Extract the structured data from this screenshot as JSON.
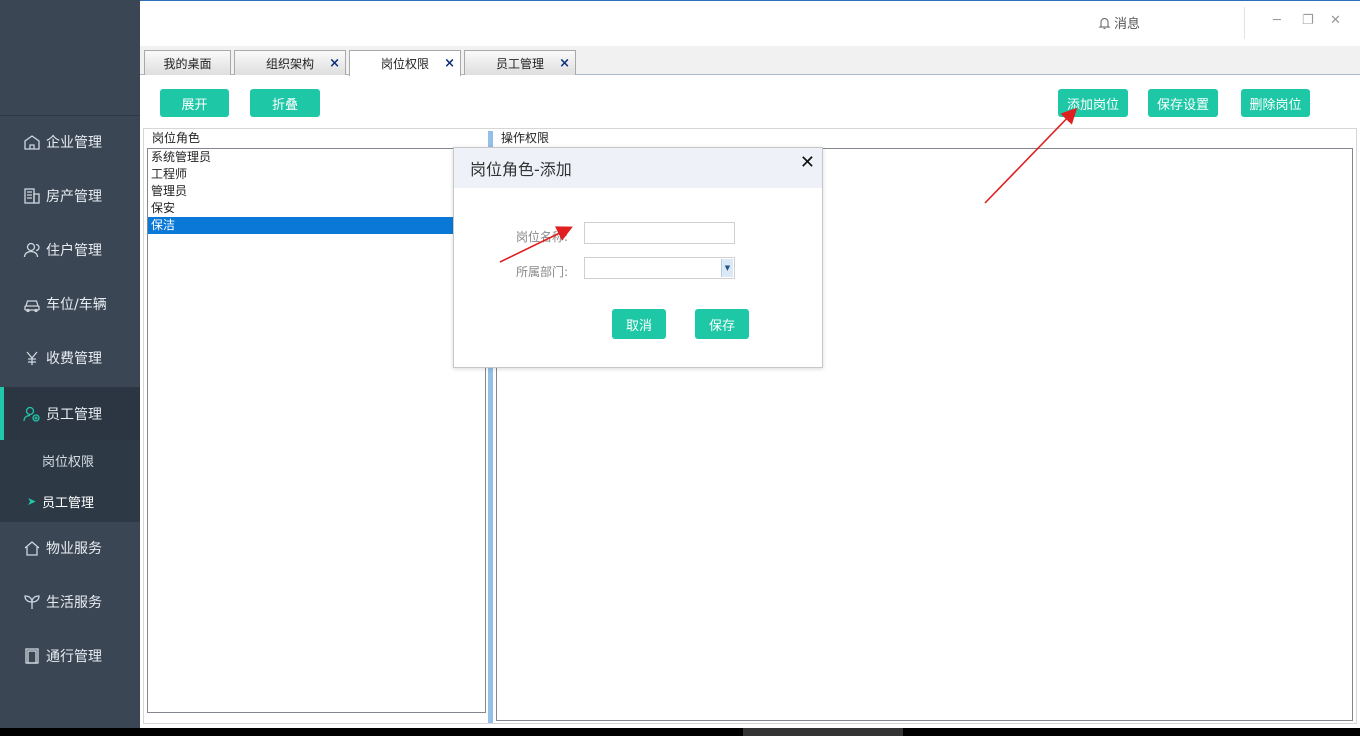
{
  "topbar": {
    "message_label": "消息",
    "minimize": "─",
    "restore": "❐",
    "close": "✕"
  },
  "sidebar": {
    "items": [
      {
        "label": "企业管理",
        "icon": "building-icon"
      },
      {
        "label": "房产管理",
        "icon": "property-icon"
      },
      {
        "label": "住户管理",
        "icon": "residents-icon"
      },
      {
        "label": "车位/车辆",
        "icon": "car-icon"
      },
      {
        "label": "收费管理",
        "icon": "yuan-icon"
      },
      {
        "label": "员工管理",
        "icon": "staff-icon"
      },
      {
        "label": "物业服务",
        "icon": "home-icon"
      },
      {
        "label": "生活服务",
        "icon": "plant-icon"
      },
      {
        "label": "通行管理",
        "icon": "door-icon"
      }
    ],
    "sub_items": [
      {
        "label": "岗位权限"
      },
      {
        "label": "员工管理",
        "arrow": "➤"
      }
    ]
  },
  "tabs": [
    {
      "label": "我的桌面"
    },
    {
      "label": "组织架构"
    },
    {
      "label": "岗位权限"
    },
    {
      "label": "员工管理"
    }
  ],
  "tab_close_glyph": "×",
  "toolbar": {
    "expand": "展开",
    "collapse": "折叠",
    "add_position": "添加岗位",
    "save_settings": "保存设置",
    "delete_position": "删除岗位"
  },
  "left_panel": {
    "title": "岗位角色",
    "items": [
      "系统管理员",
      "工程师",
      "管理员",
      "保安",
      "保洁"
    ]
  },
  "right_panel": {
    "title": "操作权限"
  },
  "dialog": {
    "title": "岗位角色-添加",
    "close": "✕",
    "name_label": "岗位名称:",
    "name_value": "",
    "dept_label": "所属部门:",
    "dept_value": "",
    "cancel": "取消",
    "save": "保存"
  },
  "colors": {
    "accent": "#1ec8a6",
    "sidebar_bg": "#3a4654",
    "selection": "#0a78d7",
    "annotation_arrow": "#e02020"
  }
}
